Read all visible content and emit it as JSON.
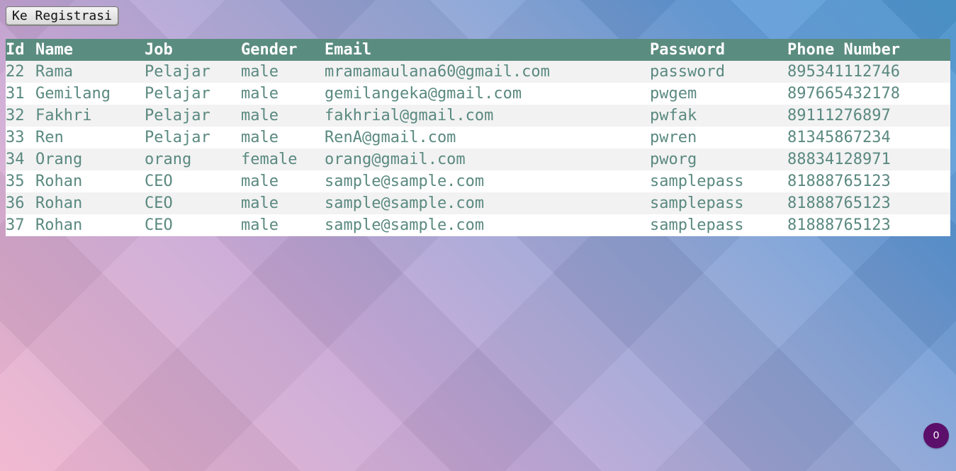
{
  "navigation": {
    "registration_button_label": "Ke Registrasi"
  },
  "users_table": {
    "headers": [
      "Id",
      "Name",
      "Job",
      "Gender",
      "Email",
      "Password",
      "Phone Number"
    ],
    "rows": [
      [
        "22",
        "Rama",
        "Pelajar",
        "male",
        "mramamaulana60@gmail.com",
        "password",
        "895341112746"
      ],
      [
        "31",
        "Gemilang",
        "Pelajar",
        "male",
        "gemilangeka@gmail.com",
        "pwgem",
        "897665432178"
      ],
      [
        "32",
        "Fakhri",
        "Pelajar",
        "male",
        "fakhrial@gmail.com",
        "pwfak",
        "89111276897"
      ],
      [
        "33",
        "Ren",
        "Pelajar",
        "male",
        "RenA@gmail.com",
        "pwren",
        "81345867234"
      ],
      [
        "34",
        "Orang",
        "orang",
        "female",
        "orang@gmail.com",
        "pworg",
        "88834128971"
      ],
      [
        "35",
        "Rohan",
        "CEO",
        "male",
        "sample@sample.com",
        "samplepass",
        "81888765123"
      ],
      [
        "36",
        "Rohan",
        "CEO",
        "male",
        "sample@sample.com",
        "samplepass",
        "81888765123"
      ],
      [
        "37",
        "Rohan",
        "CEO",
        "male",
        "sample@sample.com",
        "samplepass",
        "81888765123"
      ]
    ]
  },
  "floating_counter": {
    "value": "0"
  },
  "colors": {
    "header_background": "#5b8c80",
    "cell_text": "#5a8980",
    "odd_row_background": "#f2f2f2",
    "even_row_background": "#ffffff",
    "badge_background": "#5b0f6b"
  }
}
